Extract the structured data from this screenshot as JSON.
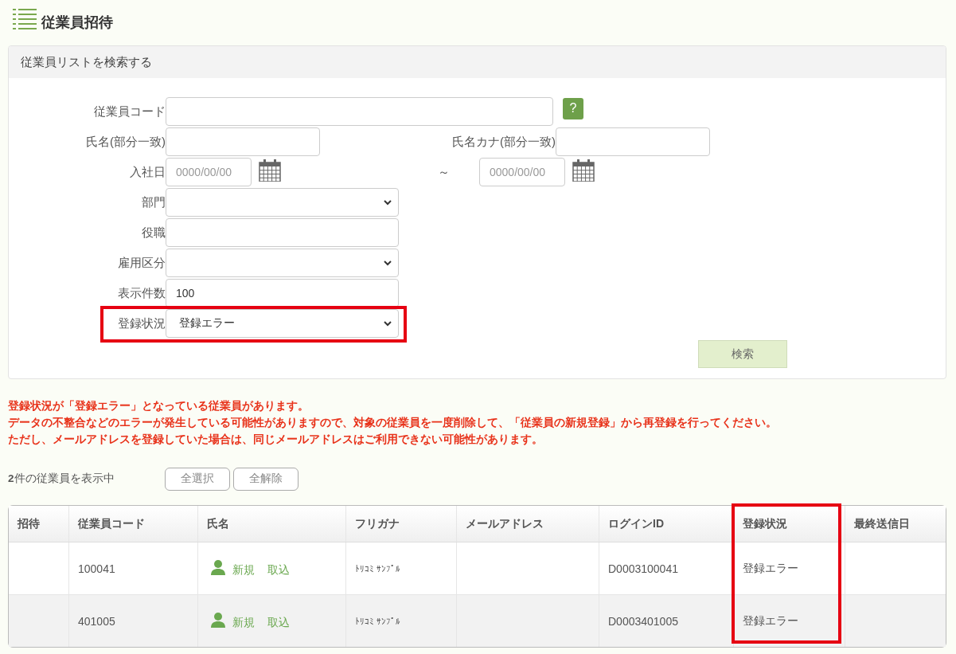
{
  "page_title": "従業員招待",
  "search_panel": {
    "title": "従業員リストを検索する",
    "fields": [
      {
        "kind": "code",
        "label": "従業員コード",
        "help": "?",
        "highlighted": false
      },
      {
        "kind": "pair",
        "label": "氏名(部分一致)",
        "label_2": "氏名カナ(部分一致)",
        "highlighted": false
      },
      {
        "kind": "date_range",
        "label": "入社日",
        "placeholder": "0000/00/00",
        "separator": "～",
        "placeholder_2": "0000/00/00",
        "highlighted": false
      },
      {
        "kind": "select",
        "label": "部門",
        "highlighted": false
      },
      {
        "kind": "text",
        "label": "役職",
        "highlighted": false
      },
      {
        "kind": "select",
        "label": "雇用区分",
        "highlighted": false
      },
      {
        "kind": "text",
        "label": "表示件数",
        "value": "100",
        "highlighted": false
      },
      {
        "kind": "select",
        "label": "登録状況",
        "value": "登録エラー",
        "highlighted": true
      }
    ],
    "search_button": "検索"
  },
  "messages": [
    "登録状況が「登録エラー」となっている従業員があります。",
    "データの不整合などのエラーが発生している可能性がありますので、対象の従業員を一度削除して、「従業員の新規登録」から再登録を行ってください。",
    "ただし、メールアドレスを登録していた場合は、同じメールアドレスはご利用できない可能性があります。"
  ],
  "result_count": "**2**件の従業員を表示中",
  "select_all": "全選択",
  "deselect_all": "全解除",
  "table": {
    "columns": [
      {
        "label": "招待",
        "highlighted": false
      },
      {
        "label": "従業員コード",
        "highlighted": false
      },
      {
        "label": "氏名",
        "highlighted": false
      },
      {
        "label": "フリガナ",
        "highlighted": false
      },
      {
        "label": "メールアドレス",
        "highlighted": false
      },
      {
        "label": "ログインID",
        "highlighted": false
      },
      {
        "label": "登録状況",
        "highlighted": true
      },
      {
        "label": "最終送信日",
        "highlighted": false
      }
    ],
    "rows": [
      {
        "code": "100041",
        "links": [
          "新規",
          "取込"
        ],
        "furigana": "ﾄﾘｺﾐ ｻﾝﾌﾟﾙ",
        "login_id": "D0003100041",
        "status": "登録エラー"
      },
      {
        "code": "401005",
        "links": [
          "新規",
          "取込"
        ],
        "furigana": "ﾄﾘｺﾐ ｻﾝﾌﾟﾙ",
        "login_id": "D0003401005",
        "status": "登録エラー"
      }
    ]
  }
}
